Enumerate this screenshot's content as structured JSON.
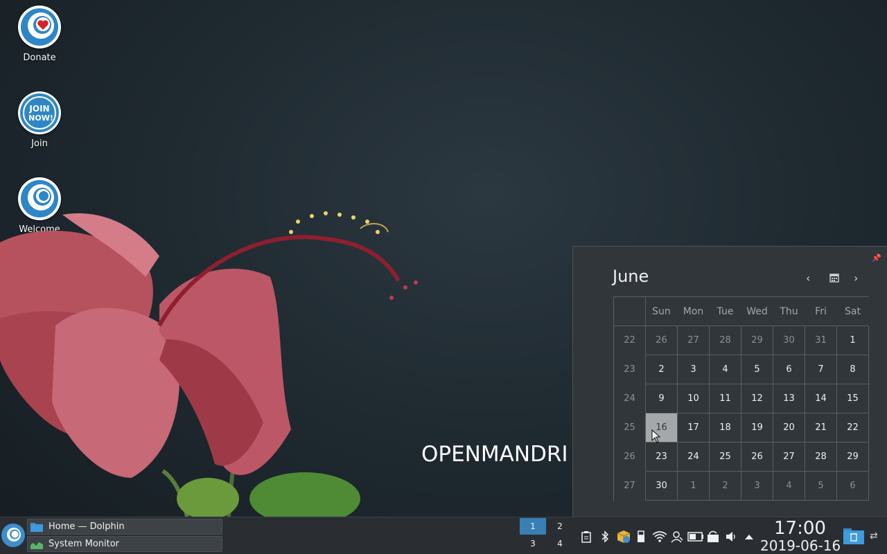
{
  "desktop": {
    "icons": [
      {
        "label": "Donate",
        "icon": "heart-icon"
      },
      {
        "label": "Join",
        "icon": "join-now-icon",
        "badge_line1": "JOIN",
        "badge_line2": "NOW!"
      },
      {
        "label": "Welcome",
        "icon": "openmandriva-icon"
      }
    ],
    "brand_text": "OPENMANDRI"
  },
  "calendar": {
    "month": "June",
    "weekday_headers": [
      "Sun",
      "Mon",
      "Tue",
      "Wed",
      "Thu",
      "Fri",
      "Sat"
    ],
    "weeks": [
      {
        "week": "22",
        "days": [
          "26",
          "27",
          "28",
          "29",
          "30",
          "31",
          "1"
        ]
      },
      {
        "week": "23",
        "days": [
          "2",
          "3",
          "4",
          "5",
          "6",
          "7",
          "8"
        ]
      },
      {
        "week": "24",
        "days": [
          "9",
          "10",
          "11",
          "12",
          "13",
          "14",
          "15"
        ]
      },
      {
        "week": "25",
        "days": [
          "16",
          "17",
          "18",
          "19",
          "20",
          "21",
          "22"
        ]
      },
      {
        "week": "26",
        "days": [
          "23",
          "24",
          "25",
          "26",
          "27",
          "28",
          "29"
        ]
      },
      {
        "week": "27",
        "days": [
          "30",
          "1",
          "2",
          "3",
          "4",
          "5",
          "6"
        ]
      }
    ],
    "today": "16"
  },
  "panel": {
    "tasks": [
      {
        "label": "Home — Dolphin",
        "icon": "folder-icon"
      },
      {
        "label": "System Monitor",
        "icon": "system-monitor-icon"
      }
    ],
    "pager": [
      "1",
      "2",
      "3",
      "4"
    ],
    "active_desktop": "1",
    "tray_icons": [
      "clipboard-icon",
      "bluetooth-icon",
      "package-updates-icon",
      "usb-device-icon",
      "wifi-icon",
      "user-switcher-icon",
      "battery-icon",
      "vault-icon",
      "volume-icon",
      "expand-tray-icon"
    ],
    "clock_time": "17:00",
    "clock_date": "2019-06-16"
  },
  "colors": {
    "accent": "#3a7fb4",
    "popup_bg": "#31363b",
    "panel_bg": "#2a2e32"
  }
}
